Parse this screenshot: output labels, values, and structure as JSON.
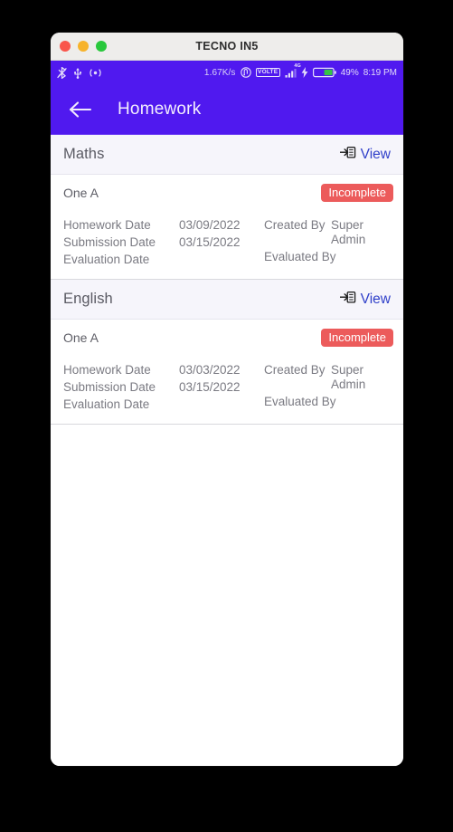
{
  "window": {
    "title": "TECNO IN5",
    "traffic_lights": [
      "close",
      "minimize",
      "zoom"
    ]
  },
  "status_bar": {
    "left_icons": [
      "bluetooth-off-icon",
      "usb-icon",
      "hotspot-icon"
    ],
    "network_speed": "1.67K/s",
    "nfc_icon": "nfc-icon",
    "volte_label": "VOLTE",
    "network_generation": "4G",
    "charging_icon": "charging-bolt-icon",
    "battery_percent": "49%",
    "clock": "8:19 PM"
  },
  "app_bar": {
    "back_icon": "back-arrow-icon",
    "title": "Homework"
  },
  "theme": {
    "primary": "#5019ef",
    "link": "#2f3fc9",
    "danger": "#ec5b5b",
    "header_bg": "#f6f5fb"
  },
  "labels": {
    "homework_date": "Homework Date",
    "submission_date": "Submission Date",
    "evaluation_date": "Evaluation Date",
    "created_by": "Created By",
    "evaluated_by": "Evaluated By",
    "view": "View"
  },
  "homework_list": [
    {
      "subject": "Maths",
      "class_name": "One A",
      "status": "Incomplete",
      "homework_date": "03/09/2022",
      "submission_date": "03/15/2022",
      "evaluation_date": "",
      "created_by": "Super Admin",
      "evaluated_by": ""
    },
    {
      "subject": "English",
      "class_name": "One A",
      "status": "Incomplete",
      "homework_date": "03/03/2022",
      "submission_date": "03/15/2022",
      "evaluation_date": "",
      "created_by": "Super Admin",
      "evaluated_by": ""
    }
  ],
  "nav_bar": {
    "recents": "recents-square-icon",
    "home": "home-circle-icon",
    "back": "back-triangle-icon"
  }
}
